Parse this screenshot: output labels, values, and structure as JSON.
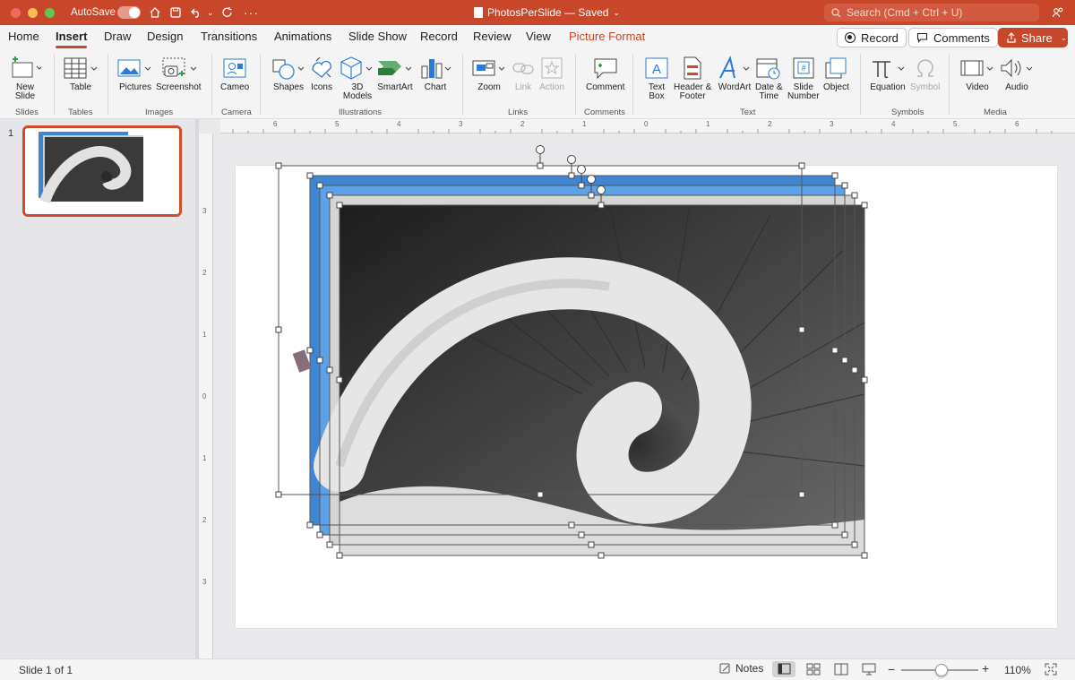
{
  "titlebar": {
    "autosave_label": "AutoSave",
    "doc_title": "PhotosPerSlide — Saved",
    "search_placeholder": "Search (Cmd + Ctrl + U)"
  },
  "tabs": [
    "Home",
    "Insert",
    "Draw",
    "Design",
    "Transitions",
    "Animations",
    "Slide Show",
    "Record",
    "Review",
    "View",
    "Picture Format"
  ],
  "active_tab": "Insert",
  "actions": {
    "record": "Record",
    "comments": "Comments",
    "share": "Share"
  },
  "ribbon": {
    "new_slide": [
      "New",
      "Slide"
    ],
    "table": "Table",
    "pictures": "Pictures",
    "screenshot": "Screenshot",
    "cameo": "Cameo",
    "shapes": "Shapes",
    "icons": "Icons",
    "models_3d": [
      "3D",
      "Models"
    ],
    "smartart": "SmartArt",
    "chart": "Chart",
    "zoom": "Zoom",
    "link": "Link",
    "action": "Action",
    "comment": "Comment",
    "text_box": [
      "Text",
      "Box"
    ],
    "header_footer": [
      "Header &",
      "Footer"
    ],
    "wordart": "WordArt",
    "date_time": [
      "Date &",
      "Time"
    ],
    "slide_number": [
      "Slide",
      "Number"
    ],
    "object": "Object",
    "equation": "Equation",
    "symbol": "Symbol",
    "video": "Video",
    "audio": "Audio"
  },
  "groups": {
    "slides": "Slides",
    "tables": "Tables",
    "images": "Images",
    "camera": "Camera",
    "illustrations": "Illustrations",
    "links": "Links",
    "comments": "Comments",
    "text": "Text",
    "symbols": "Symbols",
    "media": "Media"
  },
  "rulers": {
    "h_ticks": [
      "6",
      "5",
      "4",
      "3",
      "2",
      "1",
      "0",
      "1",
      "2",
      "3",
      "4",
      "5",
      "6"
    ],
    "v_ticks": [
      "3",
      "2",
      "1",
      "0",
      "1",
      "2",
      "3"
    ]
  },
  "thumbnail": {
    "number": "1"
  },
  "status": {
    "slide_info": "Slide 1 of 1",
    "notes": "Notes",
    "zoom": "110%"
  },
  "colors": {
    "accent": "#c8462a",
    "selected_thumb_border": "#d04a2c"
  }
}
